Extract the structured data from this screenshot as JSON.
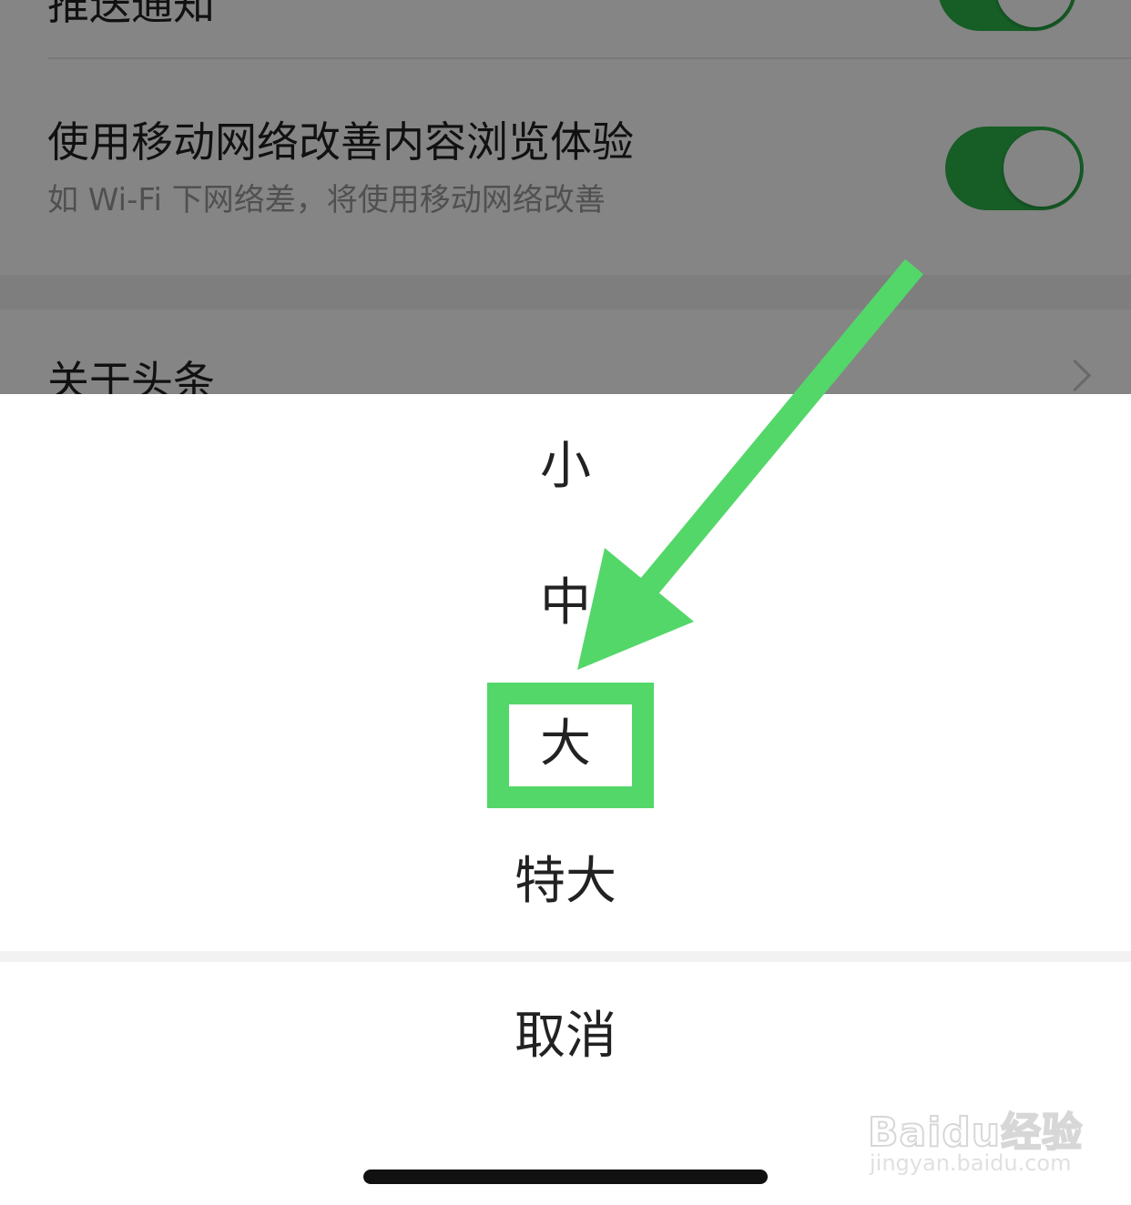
{
  "settings": {
    "push_notification_title": "推送通知",
    "mobile_data_title": "使用移动网络改善内容浏览体验",
    "mobile_data_subtitle": "如 Wi-Fi 下网络差，将使用移动网络改善",
    "about_title": "关于头条",
    "push_toggle_on": true,
    "mobile_data_toggle_on": true
  },
  "action_sheet": {
    "options": [
      "小",
      "中",
      "大",
      "特大"
    ],
    "highlighted_option": "大",
    "cancel_label": "取消"
  },
  "annotation": {
    "color": "#53d769"
  },
  "watermark": {
    "logo": "Baidu经验",
    "url": "jingyan.baidu.com"
  },
  "colors": {
    "toggle_on": "#2cb34a",
    "annotation_green": "#53d769",
    "sheet_background": "#ffffff",
    "separator": "#f2f2f2"
  }
}
